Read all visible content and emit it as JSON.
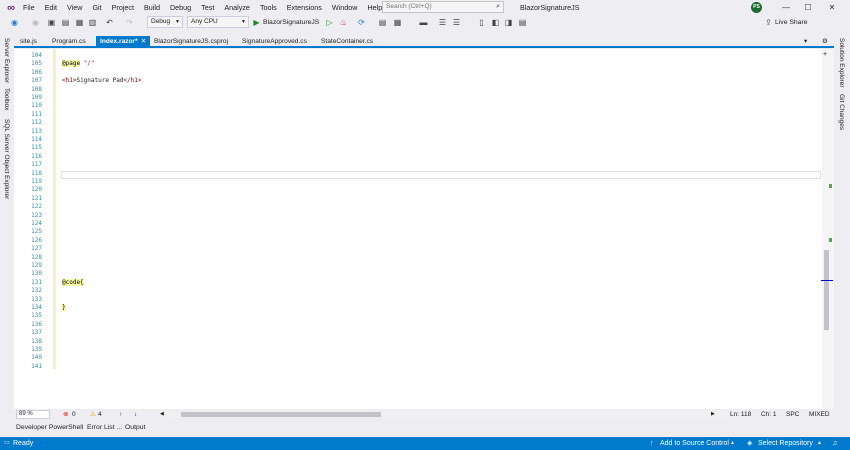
{
  "menu": [
    "File",
    "Edit",
    "View",
    "Git",
    "Project",
    "Build",
    "Debug",
    "Test",
    "Analyze",
    "Tools",
    "Extensions",
    "Window",
    "Help"
  ],
  "search": {
    "placeholder": "Search (Ctrl+Q)"
  },
  "window_title": "BlazorSignatureJS",
  "user_initials": "PS",
  "toolbar": {
    "config": "Debug",
    "platform": "Any CPU",
    "run_target": "BlazorSignatureJS",
    "live_share": "Live Share"
  },
  "left_panels": [
    "Server Explorer",
    "Toolbox",
    "SQL Server Object Explorer"
  ],
  "right_panels": [
    "Solution Explorer",
    "Git Changes"
  ],
  "tabs": [
    {
      "label": "site.js",
      "active": false
    },
    {
      "label": "Program.cs",
      "active": false
    },
    {
      "label": "Index.razor*",
      "active": true
    },
    {
      "label": "BlazorSignatureJS.csproj",
      "active": false
    },
    {
      "label": "SignatureApproved.cs",
      "active": false
    },
    {
      "label": "StateContainer.cs",
      "active": false
    }
  ],
  "editor": {
    "line_numbers": [
      "104",
      "105",
      "106",
      "107",
      "108",
      "109",
      "110",
      "111",
      "112",
      "113",
      "114",
      "115",
      "116",
      "117",
      "118",
      "119",
      "120",
      "121",
      "122",
      "123",
      "124",
      "125",
      "126",
      "127",
      "128",
      "129",
      "130",
      "131",
      "132",
      "133",
      "134",
      "135",
      "136",
      "137",
      "138",
      "139",
      "140",
      "141"
    ],
    "line_page": "@page \"/\"",
    "line_page_directive": "@page",
    "line_page_value": "\"/\"",
    "line_h1": "<h1>Signature Pad</h1>",
    "line_h1_open": "<h1>",
    "line_h1_text": "Signature Pad",
    "line_h1_close": "</h1>",
    "line_code": "@code{",
    "line_code_brace": "}"
  },
  "edit_status": {
    "zoom": "89 %",
    "errors": "0",
    "warnings": "4",
    "line": "Ln: 118",
    "col": "Ch: 1",
    "spc": "SPC",
    "eol": "MIXED"
  },
  "bottom_tabs": [
    "Developer PowerShell",
    "Error List ...",
    "Output"
  ],
  "statusbar": {
    "ready": "Ready",
    "add_source": "Add to Source Control",
    "select_repo": "Select Repository"
  },
  "colors": {
    "accent": "#007acc",
    "line_number": "#2b91af",
    "razor_highlight": "#fbfba6"
  }
}
